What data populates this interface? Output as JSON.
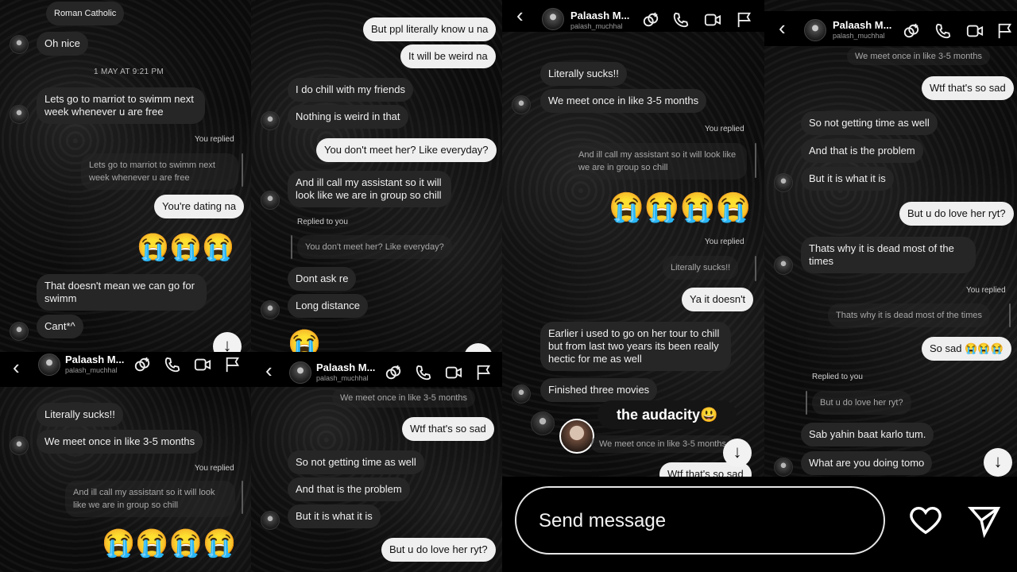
{
  "profile": {
    "name": "Palaash M...",
    "username": "palash_muchhal"
  },
  "replied_you": "You replied",
  "replied_to_you": "Replied to you",
  "crying": "😭",
  "crying4": "😭😭😭😭",
  "crying3": "😭😭😭",
  "crying2": "😭😭",
  "arrow": "↓",
  "back": "‹",
  "tl": {
    "m1": "Roman Catholic",
    "m2": "Oh nice",
    "ts": "1 MAY AT 9:21 PM",
    "m3": "Lets go to marriot to swimm next week whenever u are free",
    "q1": "Lets go to marriot to swimm next week whenever u are free",
    "m4": "You're dating na",
    "m5": "That doesn't mean we can go for swimm",
    "m6": "Cant*^"
  },
  "tm": {
    "m1": "But ppl literally know u na",
    "m2": "It will be weird na",
    "m3": "I do chill with my friends",
    "m4": "Nothing is weird in that",
    "m5": "You don't meet her? Like everyday?",
    "m6": "And ill call my assistant so it will look like we are in group so chill",
    "q1": "You don't meet her? Like everyday?",
    "m7": "Dont ask re",
    "m8": "Long distance"
  },
  "bl": {
    "m1": "Literally sucks!!",
    "m2": "We meet  once in like 3-5 months",
    "q1": "And ill call my assistant so it will look like we are in group so chill"
  },
  "bm": {
    "q0": "We meet  once in like 3-5 months",
    "m1": "Wtf that's so sad",
    "m2": "So not getting time as well",
    "m3": "And that is the problem",
    "m4": "But it is what it is",
    "m5": "But u do love her ryt?"
  },
  "c": {
    "m1": "Literally sucks!!",
    "m2": "We meet  once in like 3-5 months",
    "q1": "And ill call my assistant so it will look like we are in group so chill",
    "q2": "Literally sucks!!",
    "m3": "Ya it doesn't",
    "m4": "Earlier i used to go on her tour to chill but from last two years its been really hectic for me as well",
    "m5": "Finished three movies",
    "overlay": "the audacity😃",
    "q3": "We meet  once in like 3-5 months",
    "m6": "Wtf that's so sad"
  },
  "r": {
    "q0": "We meet  once in like 3-5 months",
    "m1": "Wtf that's so sad",
    "m2": "So not getting time as well",
    "m3": "And that is the problem",
    "m4": "But it is what it is",
    "m5": "But u do love her ryt?",
    "m6": "Thats why it is dead most of the times",
    "q1": "Thats why it is dead most of the times",
    "m7": "So sad",
    "q2": "But u do love her ryt?",
    "m8": "Sab yahin baat karlo tum.",
    "m9": "What are you doing tomo"
  },
  "composer": {
    "placeholder": "Send message"
  },
  "colors": {
    "background": "#000000",
    "incoming": "#262626",
    "outgoing": "#efefef"
  },
  "icons": [
    "back-icon",
    "link-icon",
    "phone-icon",
    "video-icon",
    "flag-icon",
    "heart-icon",
    "send-icon",
    "arrow-down-icon"
  ]
}
